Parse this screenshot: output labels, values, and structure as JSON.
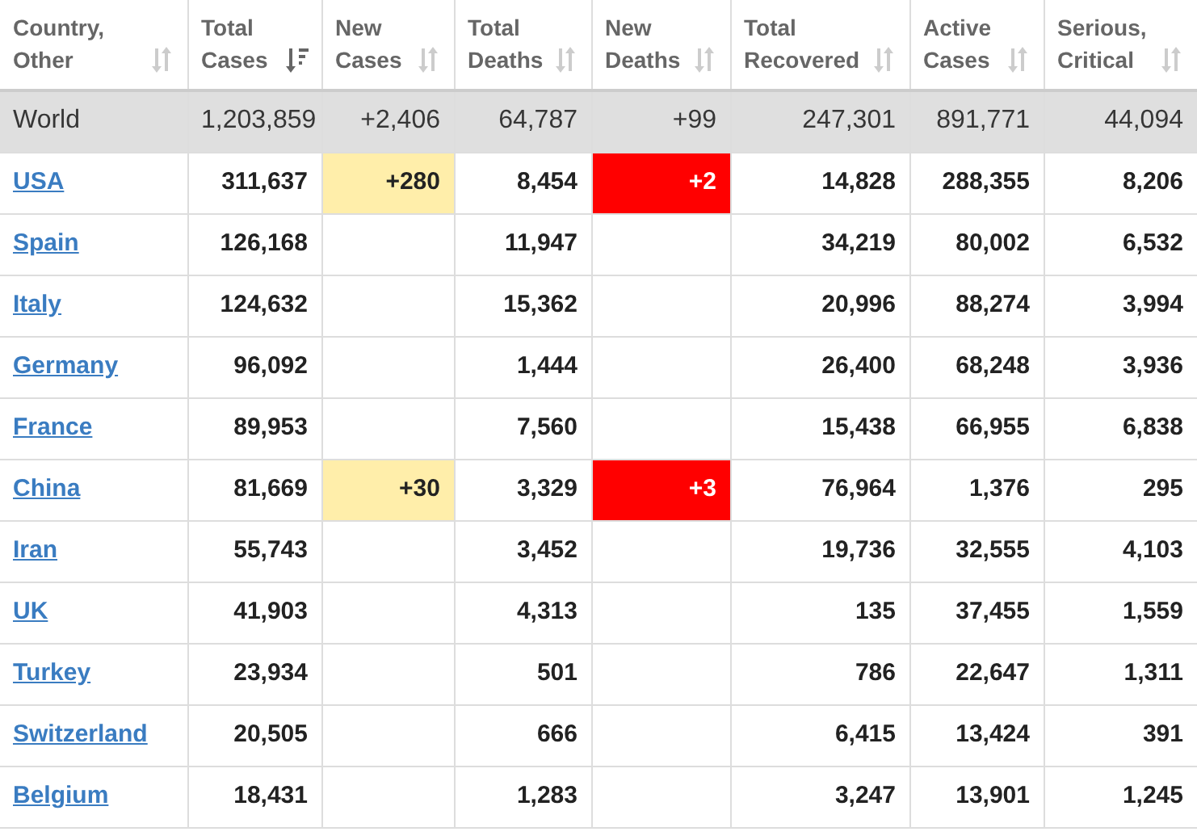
{
  "table": {
    "columns": [
      {
        "label": "Country,\nOther",
        "sorted": false
      },
      {
        "label": "Total\nCases",
        "sorted": true
      },
      {
        "label": "New\nCases",
        "sorted": false
      },
      {
        "label": "Total\nDeaths",
        "sorted": false
      },
      {
        "label": "New\nDeaths",
        "sorted": false
      },
      {
        "label": "Total\nRecovered",
        "sorted": false
      },
      {
        "label": "Active\nCases",
        "sorted": false
      },
      {
        "label": "Serious,\nCritical",
        "sorted": false
      }
    ],
    "rows": [
      {
        "kind": "total",
        "country": "World",
        "total_cases": "1,203,859",
        "new_cases": "+2,406",
        "total_deaths": "64,787",
        "new_deaths": "+99",
        "total_recovered": "247,301",
        "active_cases": "891,771",
        "serious_critical": "44,094"
      },
      {
        "kind": "country",
        "country": "USA",
        "total_cases": "311,637",
        "new_cases": "+280",
        "total_deaths": "8,454",
        "new_deaths": "+2",
        "total_recovered": "14,828",
        "active_cases": "288,355",
        "serious_critical": "8,206"
      },
      {
        "kind": "country",
        "country": "Spain",
        "total_cases": "126,168",
        "total_deaths": "11,947",
        "total_recovered": "34,219",
        "active_cases": "80,002",
        "serious_critical": "6,532"
      },
      {
        "kind": "country",
        "country": "Italy",
        "total_cases": "124,632",
        "total_deaths": "15,362",
        "total_recovered": "20,996",
        "active_cases": "88,274",
        "serious_critical": "3,994"
      },
      {
        "kind": "country",
        "country": "Germany",
        "total_cases": "96,092",
        "total_deaths": "1,444",
        "total_recovered": "26,400",
        "active_cases": "68,248",
        "serious_critical": "3,936"
      },
      {
        "kind": "country",
        "country": "France",
        "total_cases": "89,953",
        "total_deaths": "7,560",
        "total_recovered": "15,438",
        "active_cases": "66,955",
        "serious_critical": "6,838"
      },
      {
        "kind": "country",
        "country": "China",
        "total_cases": "81,669",
        "new_cases": "+30",
        "total_deaths": "3,329",
        "new_deaths": "+3",
        "total_recovered": "76,964",
        "active_cases": "1,376",
        "serious_critical": "295"
      },
      {
        "kind": "country",
        "country": "Iran",
        "total_cases": "55,743",
        "total_deaths": "3,452",
        "total_recovered": "19,736",
        "active_cases": "32,555",
        "serious_critical": "4,103"
      },
      {
        "kind": "country",
        "country": "UK",
        "total_cases": "41,903",
        "total_deaths": "4,313",
        "total_recovered": "135",
        "active_cases": "37,455",
        "serious_critical": "1,559"
      },
      {
        "kind": "country",
        "country": "Turkey",
        "total_cases": "23,934",
        "total_deaths": "501",
        "total_recovered": "786",
        "active_cases": "22,647",
        "serious_critical": "1,311"
      },
      {
        "kind": "country",
        "country": "Switzerland",
        "total_cases": "20,505",
        "total_deaths": "666",
        "total_recovered": "6,415",
        "active_cases": "13,424",
        "serious_critical": "391"
      },
      {
        "kind": "country",
        "country": "Belgium",
        "total_cases": "18,431",
        "total_deaths": "1,283",
        "total_recovered": "3,247",
        "active_cases": "13,901",
        "serious_critical": "1,245"
      }
    ]
  }
}
